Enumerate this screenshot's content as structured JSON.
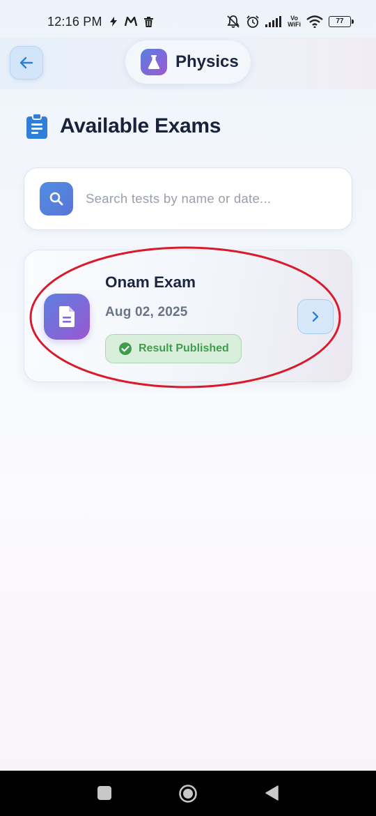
{
  "status_bar": {
    "time": "12:16 PM",
    "vowifi_top": "Vo",
    "vowifi_bottom": "WiFi",
    "battery": "77"
  },
  "header": {
    "back_icon": "arrow-left-icon",
    "subject_icon": "flask-icon",
    "title": "Physics"
  },
  "section": {
    "icon": "clipboard-icon",
    "heading": "Available Exams"
  },
  "search": {
    "icon": "search-icon",
    "placeholder": "Search tests by name or date..."
  },
  "exams": [
    {
      "icon": "document-icon",
      "name": "Onam Exam",
      "date": "Aug 02, 2025",
      "status": "Result Published",
      "status_icon": "check-circle-icon"
    }
  ],
  "nav": {
    "recents_icon": "square-icon",
    "home_icon": "circle-icon",
    "back_icon": "triangle-back-icon"
  },
  "colors": {
    "accent_blue": "#4a8fe0",
    "accent_purple": "#9a57d0",
    "success_green": "#3f9d4b",
    "annotation_red": "#d91a2a"
  }
}
